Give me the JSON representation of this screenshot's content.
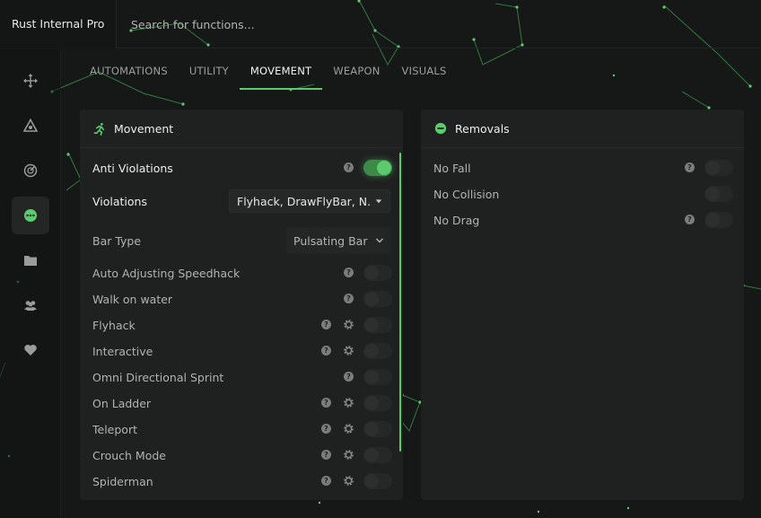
{
  "app": {
    "title": "Rust Internal Pro"
  },
  "search": {
    "placeholder": "Search for functions..."
  },
  "sidebar": {
    "items": [
      {
        "icon": "move-icon",
        "active": false
      },
      {
        "icon": "target-icon",
        "active": false
      },
      {
        "icon": "radar-icon",
        "active": false
      },
      {
        "icon": "more-icon",
        "active": true
      },
      {
        "icon": "folder-icon",
        "active": false
      },
      {
        "icon": "users-icon",
        "active": false
      },
      {
        "icon": "heart-icon",
        "active": false
      }
    ]
  },
  "tabs": [
    {
      "label": "AUTOMATIONS",
      "active": false
    },
    {
      "label": "UTILITY",
      "active": false
    },
    {
      "label": "MOVEMENT",
      "active": true
    },
    {
      "label": "WEAPON",
      "active": false
    },
    {
      "label": "VISUALS",
      "active": false
    }
  ],
  "movement": {
    "title": "Movement",
    "header_icon": "running-icon",
    "anti_violations": {
      "label": "Anti Violations",
      "enabled": true
    },
    "violations": {
      "label": "Violations",
      "value": "Flyhack, DrawFlyBar, N.."
    },
    "bar_type": {
      "label": "Bar Type",
      "value": "Pulsating Bar"
    },
    "options": [
      {
        "label": "Auto Adjusting Speedhack",
        "help": true,
        "settings": false,
        "enabled": false
      },
      {
        "label": "Walk on water",
        "help": true,
        "settings": false,
        "enabled": false
      },
      {
        "label": "Flyhack",
        "help": true,
        "settings": true,
        "enabled": false
      },
      {
        "label": "Interactive",
        "help": true,
        "settings": true,
        "enabled": false
      },
      {
        "label": "Omni Directional Sprint",
        "help": true,
        "settings": false,
        "enabled": false
      },
      {
        "label": "On Ladder",
        "help": true,
        "settings": true,
        "enabled": false
      },
      {
        "label": "Teleport",
        "help": true,
        "settings": true,
        "enabled": false
      },
      {
        "label": "Crouch Mode",
        "help": true,
        "settings": true,
        "enabled": false
      },
      {
        "label": "Spiderman",
        "help": true,
        "settings": true,
        "enabled": false
      }
    ]
  },
  "removals": {
    "title": "Removals",
    "header_icon": "minus-circle-icon",
    "options": [
      {
        "label": "No Fall",
        "help": true,
        "enabled": false
      },
      {
        "label": "No Collision",
        "help": false,
        "enabled": false
      },
      {
        "label": "No Drag",
        "help": true,
        "enabled": false
      }
    ]
  },
  "colors": {
    "accent": "#5ccb6d",
    "panel": "#1f2020",
    "background": "#161717"
  }
}
